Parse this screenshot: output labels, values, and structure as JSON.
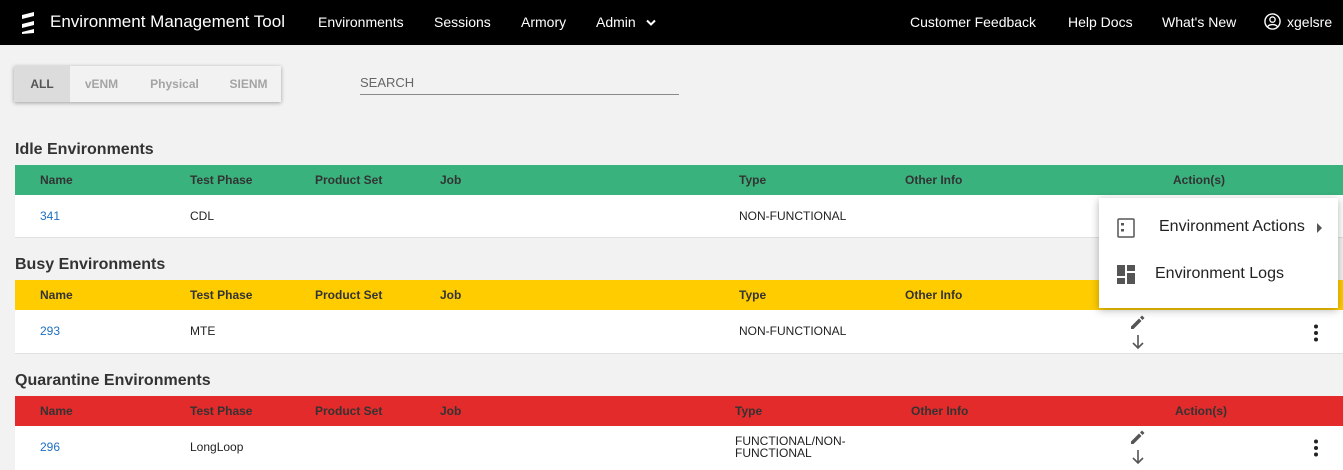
{
  "app": {
    "title": "Environment Management Tool",
    "nav": [
      "Environments",
      "Sessions",
      "Armory",
      "Admin"
    ],
    "right_nav": [
      "Customer Feedback",
      "Help Docs",
      "What's New"
    ],
    "user": "xgelsre"
  },
  "filters": {
    "tabs": [
      "ALL",
      "vENM",
      "Physical",
      "SIENM"
    ],
    "active": "ALL"
  },
  "search": {
    "placeholder": "SEARCH",
    "value": ""
  },
  "columns": [
    "Name",
    "Test Phase",
    "Product Set",
    "Job",
    "Type",
    "Other Info",
    "Action(s)"
  ],
  "sections": [
    {
      "title": "Idle Environments",
      "color": "#39b27d",
      "rows": [
        {
          "name": "341",
          "test_phase": "CDL",
          "product_set": "",
          "job": "",
          "type": "NON-FUNCTIONAL",
          "other_info": ""
        }
      ]
    },
    {
      "title": "Busy Environments",
      "color": "#ffcc00",
      "rows": [
        {
          "name": "293",
          "test_phase": "MTE",
          "product_set": "",
          "job": "",
          "type": "NON-FUNCTIONAL",
          "other_info": ""
        }
      ]
    },
    {
      "title": "Quarantine Environments",
      "color": "#e32b2b",
      "rows": [
        {
          "name": "296",
          "test_phase": "LongLoop",
          "product_set": "",
          "job": "",
          "type_line1": "FUNCTIONAL/NON-",
          "type_line2": "FUNCTIONAL",
          "other_info": ""
        }
      ]
    }
  ],
  "action_menu": {
    "items": [
      {
        "label": "Environment Actions",
        "icon": "list-icon",
        "has_submenu": true
      },
      {
        "label": "Environment Logs",
        "icon": "dashboard-icon"
      }
    ]
  },
  "icons": {
    "edit": "pencil-icon",
    "download": "arrow-down-icon",
    "more": "more-vert-icon",
    "user": "account-circle-icon"
  }
}
